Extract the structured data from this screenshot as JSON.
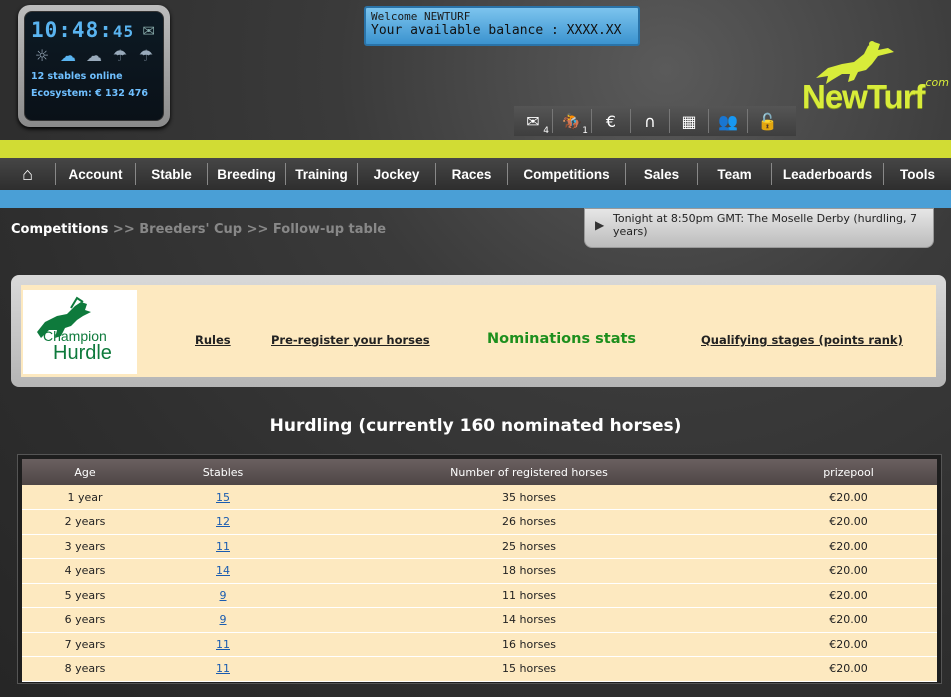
{
  "clock": {
    "hours_minutes": "10:48",
    "seconds": "45",
    "stables_online": "12 stables online",
    "ecosystem": "Ecosystem: € 132 476"
  },
  "welcome": {
    "line1": "Welcome NEWTURF",
    "line2": "Your available balance : XXXX.XX"
  },
  "logo": {
    "text": "NewTurf",
    "suffix": ".com"
  },
  "toolbar": {
    "icons": [
      {
        "name": "mail-icon",
        "glyph": "✉",
        "badge": "4"
      },
      {
        "name": "horse-race-icon",
        "glyph": "🏇",
        "badge": "1"
      },
      {
        "name": "euro-icon",
        "glyph": "€",
        "badge": ""
      },
      {
        "name": "horseshoe-icon",
        "glyph": "∩",
        "badge": ""
      },
      {
        "name": "checkered-flag-icon",
        "glyph": "▦",
        "badge": ""
      },
      {
        "name": "users-icon",
        "glyph": "👥",
        "badge": ""
      },
      {
        "name": "unlock-icon",
        "glyph": "🔓",
        "badge": ""
      }
    ]
  },
  "nav": {
    "home_glyph": "⌂",
    "items": [
      "Account",
      "Stable",
      "Breeding",
      "Training",
      "Jockey",
      "Races",
      "Competitions",
      "Sales",
      "Team",
      "Leaderboards",
      "Tools"
    ]
  },
  "breadcrumb": {
    "current": "Competitions",
    "rest": " >> Breeders' Cup >> Follow-up table"
  },
  "news": {
    "text": "Tonight at 8:50pm GMT: The Moselle Derby (hurdling, 7 years)"
  },
  "competition": {
    "logo_line1": "Champion",
    "logo_line2": "Hurdle",
    "links": {
      "rules": "Rules",
      "preregister": "Pre-register your horses",
      "nominations": "Nominations stats",
      "qualifying": "Qualifying stages (points rank)"
    }
  },
  "heading": "Hurdling (currently 160 nominated horses)",
  "table": {
    "headers": {
      "age": "Age",
      "stables": "Stables",
      "registered": "Number of registered horses",
      "prizepool": "prizepool"
    },
    "rows": [
      {
        "age": "1 year",
        "stables": "15",
        "registered": "35 horses",
        "prizepool": "€20.00"
      },
      {
        "age": "2 years",
        "stables": "12",
        "registered": "26 horses",
        "prizepool": "€20.00"
      },
      {
        "age": "3 years",
        "stables": "11",
        "registered": "25 horses",
        "prizepool": "€20.00"
      },
      {
        "age": "4 years",
        "stables": "14",
        "registered": "18 horses",
        "prizepool": "€20.00"
      },
      {
        "age": "5 years",
        "stables": "9",
        "registered": "11 horses",
        "prizepool": "€20.00"
      },
      {
        "age": "6 years",
        "stables": "9",
        "registered": "14 horses",
        "prizepool": "€20.00"
      },
      {
        "age": "7 years",
        "stables": "11",
        "registered": "16 horses",
        "prizepool": "€20.00"
      },
      {
        "age": "8 years",
        "stables": "11",
        "registered": "15 horses",
        "prizepool": "€20.00"
      }
    ]
  },
  "colors": {
    "accent_yellow": "#d1dc34",
    "accent_blue": "#4a9fd6",
    "link_green": "#1d8f1d",
    "table_bg": "#fde9c0"
  }
}
